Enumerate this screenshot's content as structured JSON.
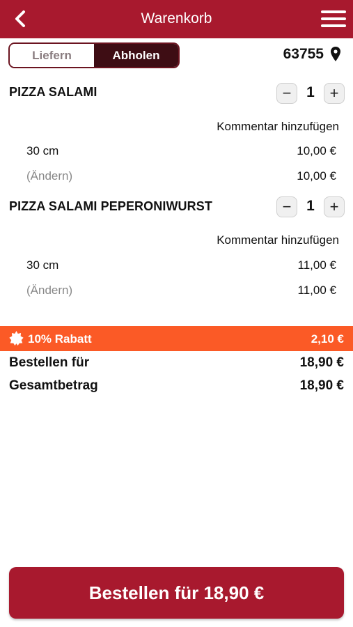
{
  "header": {
    "title": "Warenkorb",
    "back_icon": "chevron-left-icon",
    "menu_icon": "hamburger-menu-icon"
  },
  "delivery_toggle": {
    "options": [
      "Liefern",
      "Abholen"
    ],
    "selected": "Abholen"
  },
  "location": {
    "zip": "63755",
    "icon": "map-pin-icon"
  },
  "cart": {
    "items": [
      {
        "name": "PIZZA SALAMI",
        "quantity": "1",
        "comment_label": "Kommentar hinzufügen",
        "size": "30 cm",
        "size_price": "10,00 €",
        "change_label": "(Ändern)",
        "total_price": "10,00 €"
      },
      {
        "name": "PIZZA SALAMI PEPERONIWURST",
        "quantity": "1",
        "comment_label": "Kommentar hinzufügen",
        "size": "30 cm",
        "size_price": "11,00 €",
        "change_label": "(Ändern)",
        "total_price": "11,00 €"
      }
    ]
  },
  "discount": {
    "label": "10% Rabatt",
    "amount": "2,10 €",
    "icon": "badge-star-icon"
  },
  "summary": {
    "order_for_label": "Bestellen für",
    "order_for_value": "18,90 €",
    "total_label": "Gesamtbetrag",
    "total_value": "18,90 €"
  },
  "order_button": {
    "label": "Bestellen für 18,90 €"
  },
  "colors": {
    "brand": "#a8192e",
    "toggle_active": "#3e0d14",
    "discount": "#fb5a26"
  }
}
